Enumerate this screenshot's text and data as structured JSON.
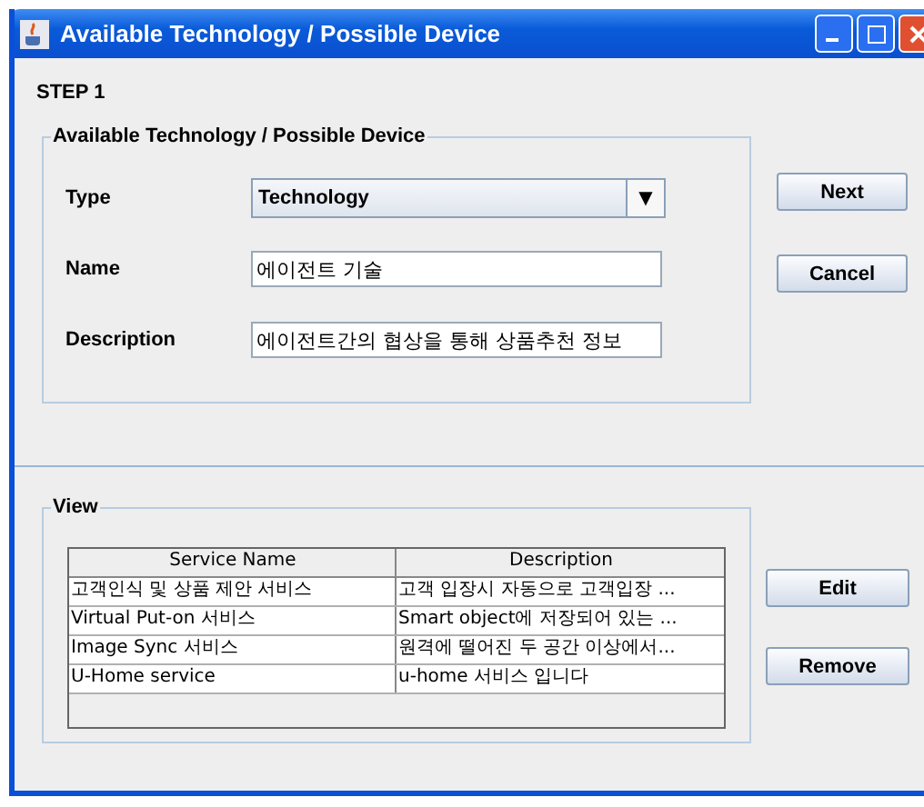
{
  "window": {
    "title": "Available Technology / Possible Device"
  },
  "step": "STEP 1",
  "form_group": {
    "title": "Available Technology / Possible Device",
    "type": {
      "label": "Type",
      "value": "Technology",
      "arrow": "▼"
    },
    "name": {
      "label": "Name",
      "value": "에이전트 기술"
    },
    "description": {
      "label": "Description",
      "value": "에이전트간의 협상을 통해 상품추천 정보"
    }
  },
  "top_buttons": [
    "Next",
    "Cancel"
  ],
  "view_group": {
    "title": "View",
    "table": {
      "columns": [
        "Service Name",
        "Description"
      ],
      "rows": [
        [
          "고객인식 및 상품 제안 서비스",
          "고객 입장시 자동으로 고객입장 ..."
        ],
        [
          "Virtual Put-on 서비스",
          "Smart object에 저장되어 있는 ..."
        ],
        [
          "Image Sync 서비스",
          "원격에 떨어진 두 공간 이상에서..."
        ],
        [
          "U-Home service",
          "u-home 서비스 입니다"
        ]
      ]
    }
  },
  "view_buttons": [
    "Edit",
    "Remove"
  ]
}
